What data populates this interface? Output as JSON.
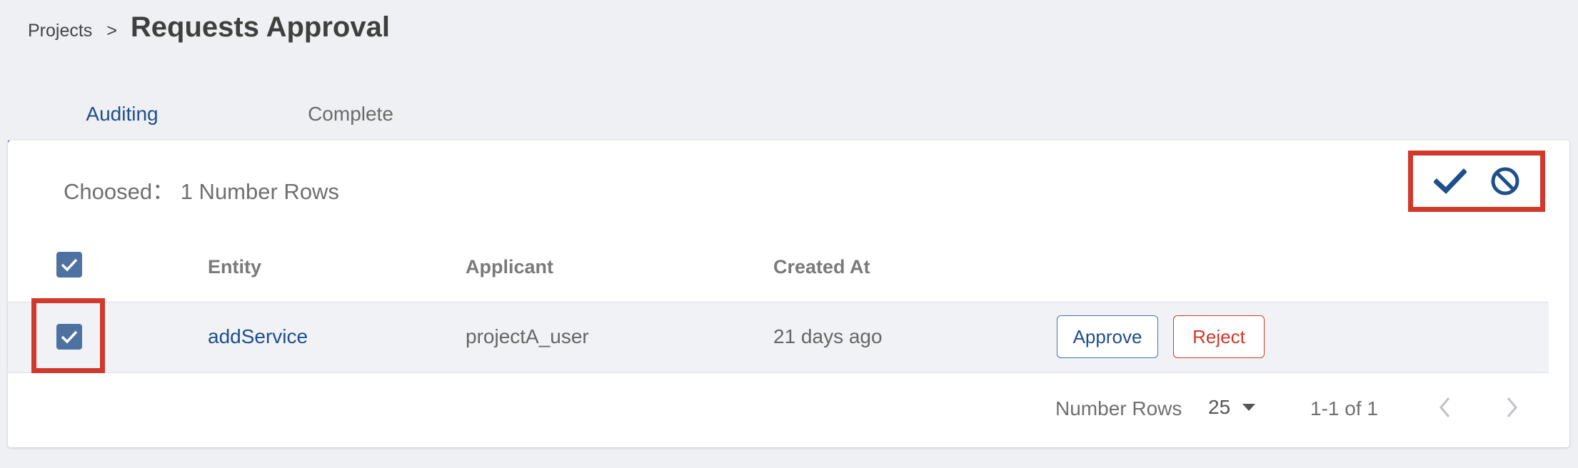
{
  "breadcrumb": {
    "parent": "Projects",
    "separator": ">",
    "title": "Requests Approval"
  },
  "tabs": [
    {
      "label": "Auditing",
      "active": true
    },
    {
      "label": "Complete",
      "active": false
    }
  ],
  "selection": {
    "text": "Choosed： 1 Number Rows"
  },
  "bulk_actions": {
    "icons": [
      "check-icon",
      "block-icon"
    ],
    "highlight_color": "#d0392b"
  },
  "table": {
    "columns": [
      "Entity",
      "Applicant",
      "Created At"
    ],
    "rows": [
      {
        "entity": "addService",
        "applicant": "projectA_user",
        "created_at": "21 days ago",
        "approve_label": "Approve",
        "reject_label": "Reject",
        "selected": true
      }
    ],
    "header_selected": true
  },
  "pagination": {
    "rows_label": "Number Rows",
    "rows_per_page": "25",
    "range": "1-1 of 1"
  },
  "colors": {
    "accent": "#1e4f8a",
    "checkbox": "#4d72a1",
    "danger": "#d0392b",
    "background": "#eef0f4"
  }
}
